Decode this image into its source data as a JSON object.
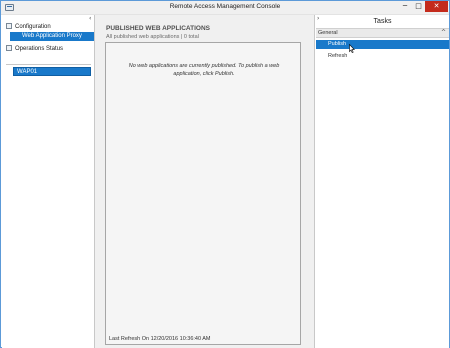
{
  "window": {
    "title": "Remote Access Management Console",
    "controls": {
      "minimize": "─",
      "maximize": "□",
      "close": "✕"
    }
  },
  "nav": {
    "collapse_glyph": "‹",
    "items": [
      {
        "label": "Configuration",
        "icon": "configuration-icon"
      },
      {
        "label": "Web Application Proxy",
        "selected": true
      },
      {
        "label": "Operations Status",
        "icon": "operations-status-icon"
      }
    ],
    "servers": [
      {
        "label": "WAP01",
        "selected": true
      }
    ]
  },
  "main": {
    "heading": "PUBLISHED WEB APPLICATIONS",
    "subheading": "All published web applications | 0 total",
    "empty_message": "No web applications are currently published. To publish a web application, click Publish.",
    "last_refresh": "Last Refresh On 12/20/2016 10:36:40 AM"
  },
  "tasks": {
    "expand_glyph": "›",
    "title": "Tasks",
    "section": {
      "label": "General",
      "chevron": "^"
    },
    "items": [
      {
        "label": "Publish",
        "selected": true
      },
      {
        "label": "Refresh"
      }
    ]
  },
  "colors": {
    "selection": "#1979ca",
    "close_button": "#c42b1c",
    "window_border": "#5c9ad8"
  }
}
